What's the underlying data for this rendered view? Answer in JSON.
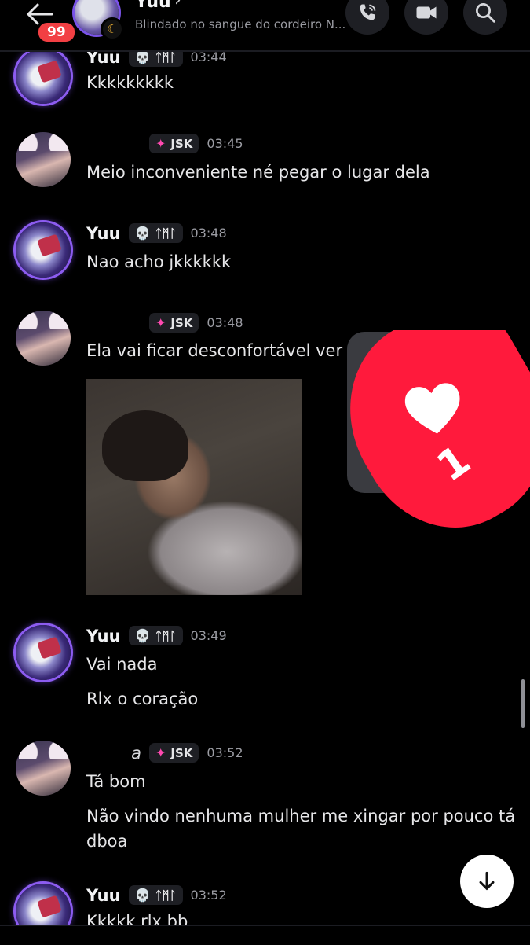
{
  "header": {
    "unread_badge": "99",
    "title": "Yuu",
    "status": "Blindado no sangue do cordeiro N..."
  },
  "messages": [
    {
      "user": "Yuu",
      "tag": "ᛏᛗᛚ",
      "time": "03:44",
      "lines": [
        "Kkkkkkkkk"
      ]
    },
    {
      "user": "",
      "tag": "JSK",
      "time": "03:45",
      "lines": [
        "Meio inconveniente né pegar o lugar dela"
      ]
    },
    {
      "user": "Yuu",
      "tag": "ᛏᛗᛚ",
      "time": "03:48",
      "lines": [
        "Nao acho jkkkkkk"
      ]
    },
    {
      "user": "",
      "tag": "JSK",
      "time": "03:48",
      "lines": [
        "Ela vai ficar desconfortável ver vo"
      ]
    },
    {
      "user": "Yuu",
      "tag": "ᛏᛗᛚ",
      "time": "03:49",
      "lines": [
        "Vai nada",
        "Rlx o coração"
      ]
    },
    {
      "user": "a",
      "tag": "JSK",
      "time": "03:52",
      "lines": [
        "Tá bom",
        "Não vindo nenhuma mulher me xingar por pouco tá",
        "dboa"
      ]
    },
    {
      "user": "Yuu",
      "tag": "ᛏᛗᛚ",
      "time": "03:52",
      "lines": [
        "Kkkkk rlx bb"
      ]
    }
  ],
  "reaction": {
    "count": "1",
    "icon": "heart-icon"
  },
  "colors": {
    "accent": "#7a53e8",
    "badge": "#f23f43",
    "reaction": "#ff1a3c"
  }
}
